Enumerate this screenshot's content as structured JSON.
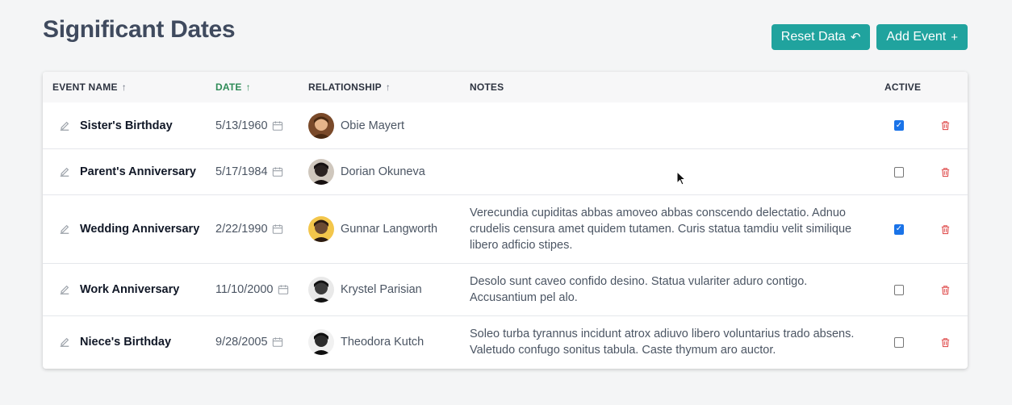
{
  "page": {
    "title": "Significant Dates"
  },
  "toolbar": {
    "reset_label": "Reset Data",
    "reset_icon": "undo-icon",
    "add_label": "Add Event",
    "add_icon": "plus-icon"
  },
  "table": {
    "headers": {
      "event_name": "EVENT NAME",
      "date": "DATE",
      "relationship": "RELATIONSHIP",
      "notes": "NOTES",
      "active": "ACTIVE"
    },
    "rows": [
      {
        "name": "Sister's Birthday",
        "date": "5/13/1960",
        "person": "Obie Mayert",
        "notes": "",
        "active": true
      },
      {
        "name": "Parent's Anniversary",
        "date": "5/17/1984",
        "person": "Dorian Okuneva",
        "notes": "",
        "active": false
      },
      {
        "name": "Wedding Anniversary",
        "date": "2/22/1990",
        "person": "Gunnar Langworth",
        "notes": "Verecundia cupiditas abbas amoveo abbas conscendo delectatio. Adnuo crudelis censura amet quidem tutamen. Curis statua tamdiu velit similique libero adficio stipes.",
        "active": true
      },
      {
        "name": "Work Anniversary",
        "date": "11/10/2000",
        "person": "Krystel Parisian",
        "notes": "Desolo sunt caveo confido desino. Statua vulariter aduro contigo. Accusantium pel alo.",
        "active": false
      },
      {
        "name": "Niece's Birthday",
        "date": "9/28/2005",
        "person": "Theodora Kutch",
        "notes": "Soleo turba tyrannus incidunt atrox adiuvo libero voluntarius trado absens. Valetudo confugo sonitus tabula. Caste thymum aro auctor.",
        "active": false
      }
    ]
  },
  "colors": {
    "accent": "#20a39e",
    "sorted_header": "#2e8b57",
    "delete": "#e05252",
    "title": "#3f4a5e"
  }
}
